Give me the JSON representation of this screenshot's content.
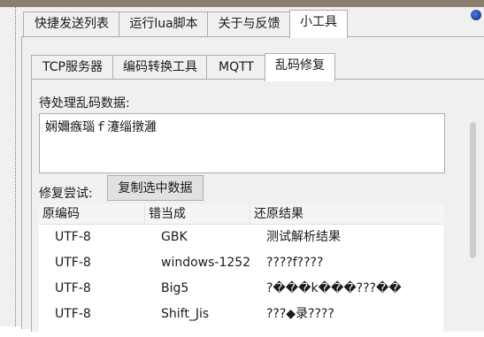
{
  "outer_tabs": [
    {
      "label": "快捷发送列表",
      "active": false
    },
    {
      "label": "运行lua脚本",
      "active": false
    },
    {
      "label": "关于与反馈",
      "active": false
    },
    {
      "label": "小工具",
      "active": true
    }
  ],
  "inner_tabs": [
    {
      "label": "TCP服务器",
      "active": false
    },
    {
      "label": "编码转换工具",
      "active": false
    },
    {
      "label": "MQTT",
      "active": false
    },
    {
      "label": "乱码修复",
      "active": true
    }
  ],
  "garbled": {
    "label": "待处理乱码数据:",
    "value": "娴嬭瘯瑙ｆ瀽缁撴灉"
  },
  "repair": {
    "label": "修复尝试:",
    "copy_button": "复制选中数据"
  },
  "table": {
    "headers": [
      "原编码",
      "错当成",
      "还原结果"
    ],
    "rows": [
      [
        "UTF-8",
        "GBK",
        "测试解析结果"
      ],
      [
        "UTF-8",
        "windows-1252",
        "????f????"
      ],
      [
        "UTF-8",
        "Big5",
        "?���k���???��"
      ],
      [
        "UTF-8",
        "Shift_Jis",
        "???◆录????"
      ]
    ]
  }
}
